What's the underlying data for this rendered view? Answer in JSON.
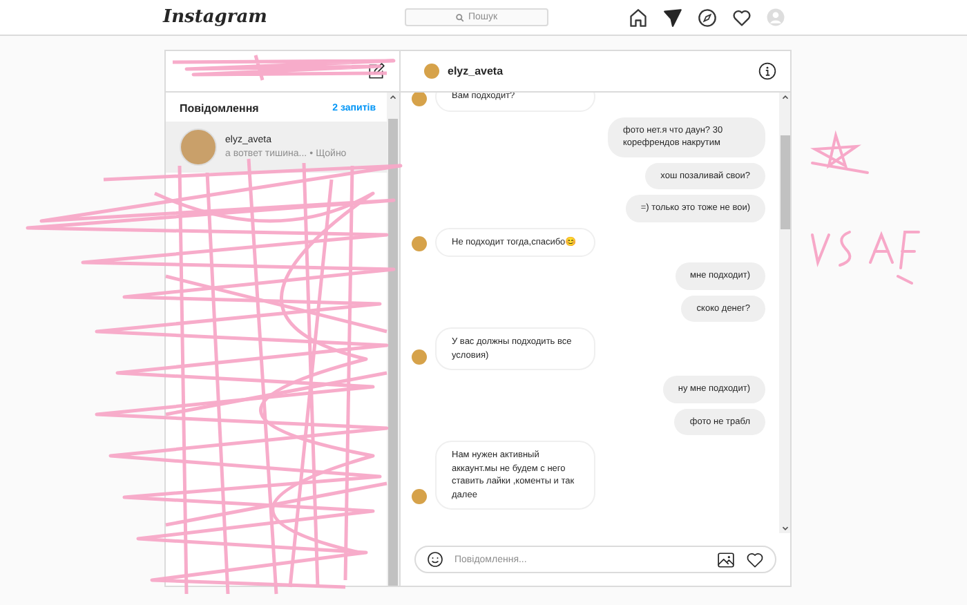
{
  "topbar": {
    "logo": "Instagram",
    "search": {
      "placeholder": "Пошук"
    },
    "nav": [
      {
        "kind": "home",
        "selected": false
      },
      {
        "kind": "direct",
        "selected": true
      },
      {
        "kind": "explore",
        "selected": false
      },
      {
        "kind": "activity",
        "selected": false
      },
      {
        "kind": "profile",
        "selected": false
      }
    ]
  },
  "inbox": {
    "heading": "Повідомлення",
    "requests": "2 запитів",
    "conversations": [
      {
        "name": "elyz_aveta",
        "preview": "а вответ тишина...",
        "separator": "•",
        "time": "Щойно",
        "selected": true
      }
    ]
  },
  "chat": {
    "title": "elyz_aveta",
    "messages": [
      {
        "kind": "received",
        "text": "Вам подходит?"
      },
      {
        "kind": "sent",
        "text": "фото нет.я что даун? 30 корефрендов накрутим"
      },
      {
        "kind": "sent",
        "text": "хош позаливай свои?"
      },
      {
        "kind": "sent",
        "text": "=) только это тоже не вои)"
      },
      {
        "kind": "received",
        "text": "Не подходит тогда,спасибо😊"
      },
      {
        "kind": "sent",
        "text": "мне подходит)"
      },
      {
        "kind": "sent",
        "text": "скоко денег?"
      },
      {
        "kind": "received",
        "text": "У вас должны подходить все условия)"
      },
      {
        "kind": "sent",
        "text": "ну мне подходит)"
      },
      {
        "kind": "sent",
        "text": "фото не трабл"
      },
      {
        "kind": "received",
        "text": "Нам нужен активный аккаунт.мы не будем с него ставить лайки ,коменты и так далее"
      }
    ],
    "composer": {
      "placeholder": "Повідомлення..."
    }
  }
}
